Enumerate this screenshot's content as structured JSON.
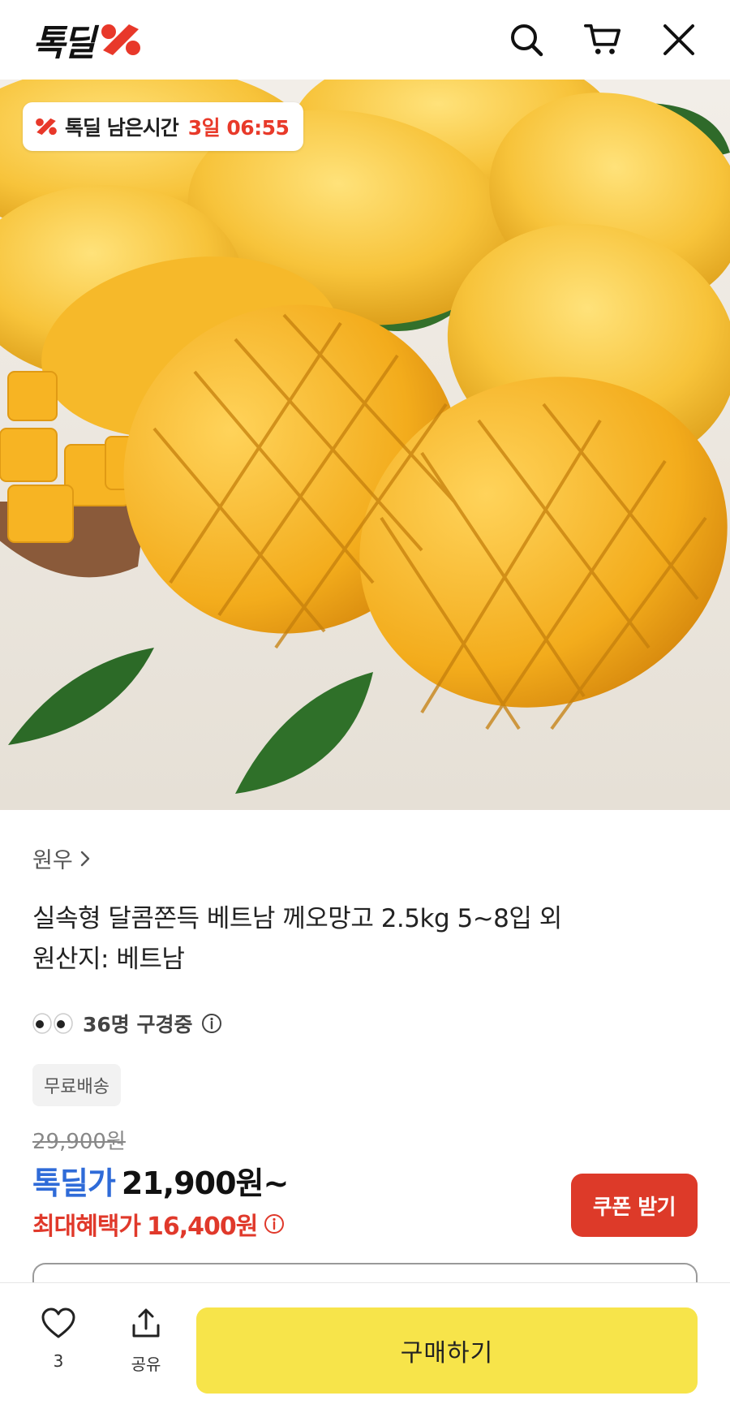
{
  "header": {
    "logo_text": "톡딜",
    "icons": [
      "search-icon",
      "cart-icon",
      "close-icon"
    ]
  },
  "hero": {
    "timer_label": "톡딜 남은시간",
    "timer_value": "3일 06:55"
  },
  "product": {
    "seller": "원우",
    "title_line1": "실속형 달콤쫀득 베트남 께오망고 2.5kg 5~8입 외",
    "title_line2": "원산지: 베트남",
    "viewers_text": "36명 구경중",
    "free_shipping": "무료배송"
  },
  "price": {
    "original": "29,900원",
    "deal_label": "톡딜가",
    "deal_price": "21,900원~",
    "max_label": "최대혜택가",
    "max_price": "16,400원",
    "coupon_button": "쿠폰 받기"
  },
  "bottom_bar": {
    "like_count": "3",
    "share_label": "공유",
    "buy_label": "구매하기"
  },
  "colors": {
    "brand_red": "#e83a2a",
    "deal_blue": "#2f6bd8",
    "buy_yellow": "#f7e44a"
  }
}
